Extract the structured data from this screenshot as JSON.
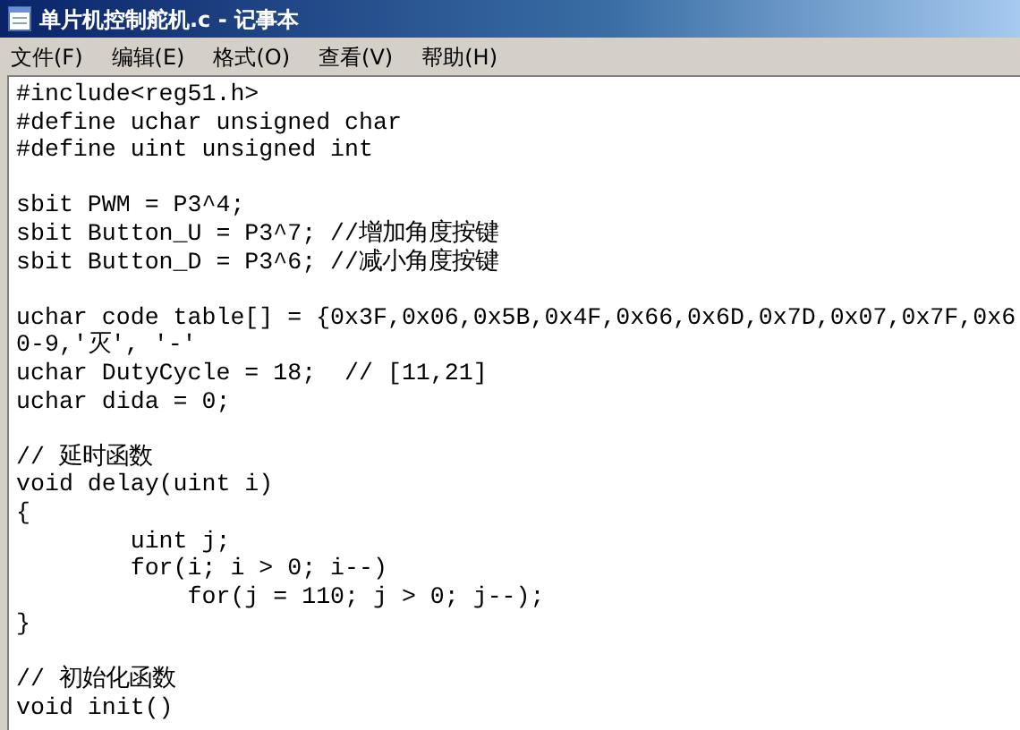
{
  "window": {
    "title": "单片机控制舵机.c - 记事本"
  },
  "menu": [
    "文件(F)",
    "编辑(E)",
    "格式(O)",
    "查看(V)",
    "帮助(H)"
  ],
  "editor": {
    "blocks": [
      [
        "#include<reg51.h>",
        "#define uchar unsigned char",
        "#define uint unsigned int"
      ],
      [
        "sbit PWM = P3^4;",
        "sbit Button_U = P3^7; //增加角度按键",
        "sbit Button_D = P3^6; //减小角度按键"
      ],
      [
        "uchar code table[] = {0x3F,0x06,0x5B,0x4F,0x66,0x6D,0x7D,0x07,0x7F,0x6",
        "0-9,'灭', '-'",
        "uchar DutyCycle = 18;  // [11,21]",
        "uchar dida = 0;"
      ],
      [
        "// 延时函数",
        "void delay(uint i)",
        "{",
        "        uint j;",
        "        for(i; i > 0; i--)",
        "            for(j = 110; j > 0; j--);",
        "}"
      ],
      [
        "// 初始化函数",
        "void init()"
      ]
    ]
  }
}
